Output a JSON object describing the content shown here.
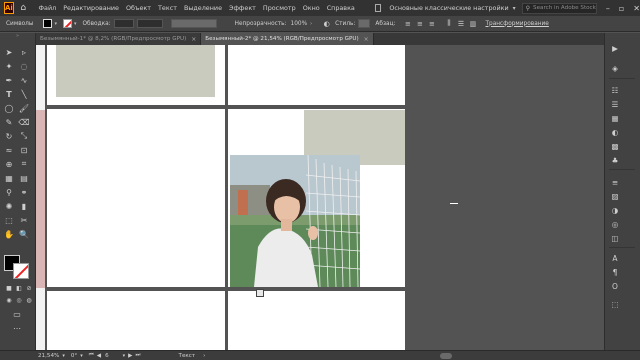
{
  "app": {
    "logo_text": "Ai"
  },
  "menu": [
    "Файл",
    "Редактирование",
    "Объект",
    "Текст",
    "Выделение",
    "Эффект",
    "Просмотр",
    "Окно",
    "Справка"
  ],
  "workspace": {
    "label": "Основные классические настройки"
  },
  "search": {
    "placeholder": "Search in Adobe Stock"
  },
  "control": {
    "tool_label": "Символы",
    "stroke_label": "Обводка:",
    "opacity_label": "Непрозрачность:",
    "opacity_value": "100%",
    "style_label": "Стиль:",
    "paragraph_label": "Абзац:",
    "transform_link": "Трансформирование"
  },
  "tabs": [
    {
      "label": "Безымянный-1* @ 8,2% (RGB/Предпросмотр GPU)",
      "active": false
    },
    {
      "label": "Безымянный-2* @ 21,54% (RGB/Предпросмотр GPU)",
      "active": true
    }
  ],
  "status": {
    "zoom": "21,54%",
    "angle": "0°",
    "page": "6",
    "tool": "Текст"
  },
  "colors": {
    "accent_orange": "#ff9a00",
    "shape_gray": "#cacbbf",
    "ui_dark": "#323232",
    "canvas": "#535353"
  }
}
